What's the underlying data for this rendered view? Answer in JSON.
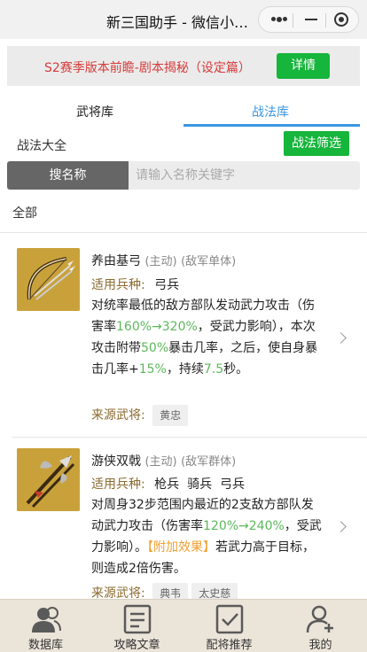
{
  "window": {
    "title": "新三国助手 - 微信小程序"
  },
  "banner": {
    "text": "S2赛季版本前瞻-剧本揭秘（设定篇）",
    "button": "详情"
  },
  "tabs": [
    {
      "label": "武将库",
      "active": false
    },
    {
      "label": "战法库",
      "active": true
    }
  ],
  "section": {
    "title": "战法大全",
    "filter_button": "战法筛选"
  },
  "search": {
    "tag": "搜名称",
    "placeholder": "请输入名称关键字"
  },
  "filter": {
    "current": "全部"
  },
  "skills": [
    {
      "name": "养由基弓",
      "type": "(主动)",
      "target": "(敌军单体)",
      "troops_label": "适用兵种:",
      "troops": "弓兵",
      "desc": [
        {
          "t": "对统率最低的敌方部队发动武力攻击（伤害率"
        },
        {
          "t": "160%→320%",
          "c": "g"
        },
        {
          "t": "，受武力影响），本次攻击附带"
        },
        {
          "t": "50%",
          "c": "g"
        },
        {
          "t": "暴击几率，之后，使自身暴击几率+"
        },
        {
          "t": "15%",
          "c": "g"
        },
        {
          "t": "，持续"
        },
        {
          "t": "7.5",
          "c": "g"
        },
        {
          "t": "秒。"
        }
      ],
      "source_label": "来源武将:",
      "sources": [
        "黄忠"
      ]
    },
    {
      "name": "游侠双戟",
      "type": "(主动)",
      "target": "(敌军群体)",
      "troops_label": "适用兵种:",
      "troops": "枪兵  骑兵  弓兵",
      "desc": [
        {
          "t": "对周身32步范围内最近的2支敌方部队发动武力攻击（伤害率"
        },
        {
          "t": "120%→240%",
          "c": "g"
        },
        {
          "t": "，受武力影响）。"
        },
        {
          "t": "【附加效果】",
          "c": "o"
        },
        {
          "t": "若武力高于目标，则造成2倍伤害。"
        }
      ],
      "source_label": "来源武将:",
      "sources": [
        "典韦",
        "太史慈"
      ]
    }
  ],
  "bottom_nav": [
    {
      "label": "数据库",
      "icon": "users-icon"
    },
    {
      "label": "攻略文章",
      "icon": "article-icon"
    },
    {
      "label": "配将推荐",
      "icon": "checkbox-icon"
    },
    {
      "label": "我的",
      "icon": "user-add-icon"
    }
  ]
}
